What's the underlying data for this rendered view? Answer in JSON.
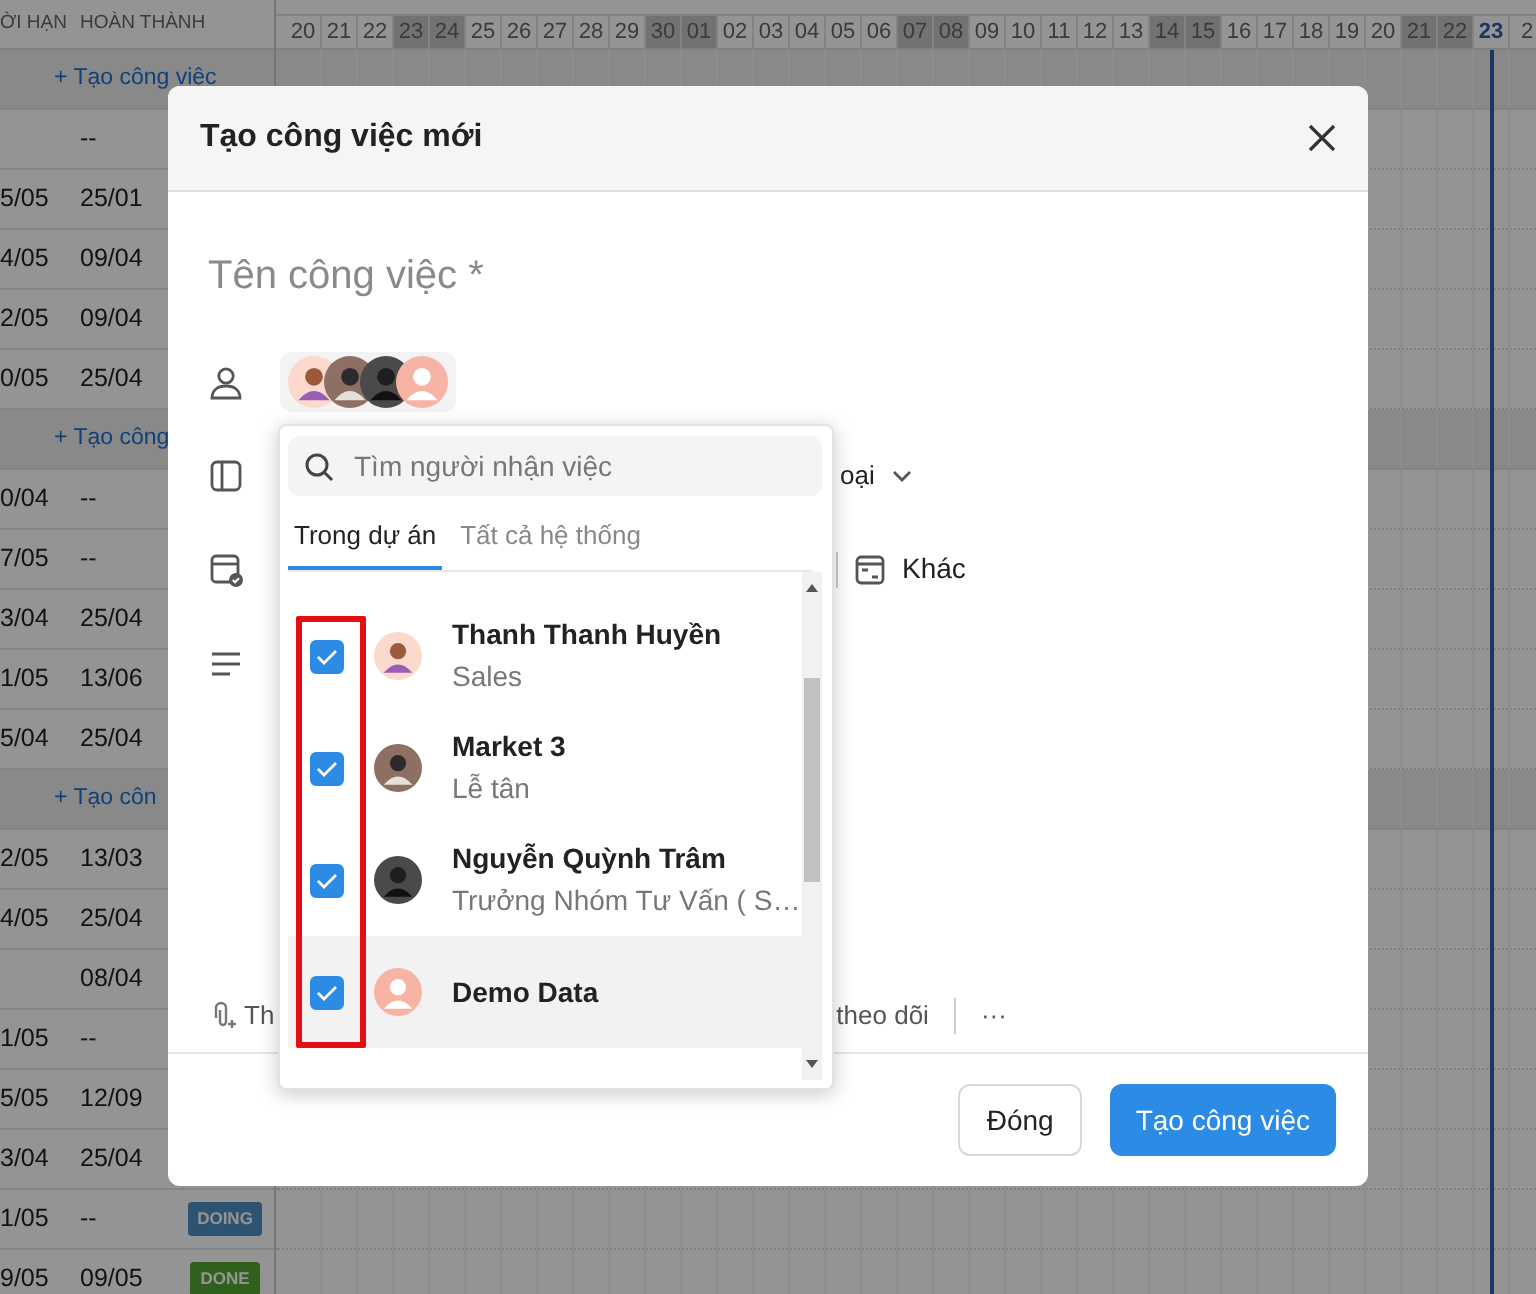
{
  "timeline": {
    "columns": [
      "ỜI HẠN",
      "HOÀN THÀNH"
    ],
    "rows": [
      {
        "kind": "group",
        "label": "+ Tạo công việc"
      },
      {
        "kind": "task",
        "completed": "--"
      },
      {
        "kind": "task",
        "deadline": "5/05",
        "completed": "25/01"
      },
      {
        "kind": "task",
        "deadline": "4/05",
        "completed": "09/04"
      },
      {
        "kind": "task",
        "deadline": "2/05",
        "completed": "09/04"
      },
      {
        "kind": "task",
        "deadline": "0/05",
        "completed": "25/04"
      },
      {
        "kind": "group",
        "label": "+ Tạo công"
      },
      {
        "kind": "task",
        "deadline": "0/04",
        "completed": "--"
      },
      {
        "kind": "task",
        "deadline": "7/05",
        "completed": "--"
      },
      {
        "kind": "task",
        "deadline": "3/04",
        "completed": "25/04"
      },
      {
        "kind": "task",
        "deadline": "1/05",
        "completed": "13/06"
      },
      {
        "kind": "task",
        "deadline": "5/04",
        "completed": "25/04"
      },
      {
        "kind": "group",
        "label": "+ Tạo côn"
      },
      {
        "kind": "task",
        "deadline": "2/05",
        "completed": "13/03"
      },
      {
        "kind": "task",
        "deadline": "4/05",
        "completed": "25/04"
      },
      {
        "kind": "task",
        "completed": "08/04"
      },
      {
        "kind": "task",
        "deadline": "1/05",
        "completed": "--"
      },
      {
        "kind": "task",
        "deadline": "5/05",
        "completed": "12/09"
      },
      {
        "kind": "task",
        "deadline": "3/04",
        "completed": "25/04"
      },
      {
        "kind": "task",
        "deadline": "1/05",
        "completed": "--",
        "status": {
          "label": "DOING",
          "kind": "doing"
        }
      },
      {
        "kind": "task",
        "deadline": "9/05",
        "completed": "09/05",
        "status": {
          "label": "DONE",
          "kind": "done"
        }
      }
    ],
    "days": [
      {
        "label": "20",
        "weekend": false,
        "today": false
      },
      {
        "label": "21",
        "weekend": false,
        "today": false
      },
      {
        "label": "22",
        "weekend": false,
        "today": false
      },
      {
        "label": "23",
        "weekend": true,
        "today": false
      },
      {
        "label": "24",
        "weekend": true,
        "today": false
      },
      {
        "label": "25",
        "weekend": false,
        "today": false
      },
      {
        "label": "26",
        "weekend": false,
        "today": false
      },
      {
        "label": "27",
        "weekend": false,
        "today": false
      },
      {
        "label": "28",
        "weekend": false,
        "today": false
      },
      {
        "label": "29",
        "weekend": false,
        "today": false
      },
      {
        "label": "30",
        "weekend": true,
        "today": false
      },
      {
        "label": "01",
        "weekend": true,
        "today": false
      },
      {
        "label": "02",
        "weekend": false,
        "today": false
      },
      {
        "label": "03",
        "weekend": false,
        "today": false
      },
      {
        "label": "04",
        "weekend": false,
        "today": false
      },
      {
        "label": "05",
        "weekend": false,
        "today": false
      },
      {
        "label": "06",
        "weekend": false,
        "today": false
      },
      {
        "label": "07",
        "weekend": true,
        "today": false
      },
      {
        "label": "08",
        "weekend": true,
        "today": false
      },
      {
        "label": "09",
        "weekend": false,
        "today": false
      },
      {
        "label": "10",
        "weekend": false,
        "today": false
      },
      {
        "label": "11",
        "weekend": false,
        "today": false
      },
      {
        "label": "12",
        "weekend": false,
        "today": false
      },
      {
        "label": "13",
        "weekend": false,
        "today": false
      },
      {
        "label": "14",
        "weekend": true,
        "today": false
      },
      {
        "label": "15",
        "weekend": true,
        "today": false
      },
      {
        "label": "16",
        "weekend": false,
        "today": false
      },
      {
        "label": "17",
        "weekend": false,
        "today": false
      },
      {
        "label": "18",
        "weekend": false,
        "today": false
      },
      {
        "label": "19",
        "weekend": false,
        "today": false
      },
      {
        "label": "20",
        "weekend": false,
        "today": false
      },
      {
        "label": "21",
        "weekend": true,
        "today": false
      },
      {
        "label": "22",
        "weekend": true,
        "today": false
      },
      {
        "label": "23",
        "weekend": false,
        "today": true
      },
      {
        "label": "2",
        "weekend": false,
        "today": false
      }
    ]
  },
  "dialog": {
    "title": "Tạo công việc mới",
    "name_placeholder": "Tên công việc *",
    "type_label": "oại",
    "other_label": "Khác",
    "toolbar": [
      {
        "kind": "attach",
        "label": "Th"
      },
      {
        "kind": "follow",
        "label": "theo dõi"
      },
      {
        "kind": "more",
        "label": "···"
      }
    ],
    "buttons": [
      {
        "kind": "secondary",
        "label": "Đóng"
      },
      {
        "kind": "primary",
        "label": "Tạo công việc"
      }
    ]
  },
  "picker": {
    "search_placeholder": "Tìm người nhận việc",
    "tabs": [
      {
        "label": "Trong dự án",
        "selected": true
      },
      {
        "label": "Tất cả hệ thống",
        "selected": false
      }
    ],
    "members": [
      {
        "name": "Thanh Thanh Huyền",
        "role": "Sales",
        "checked": true,
        "hovered": false
      },
      {
        "name": "Market 3",
        "role": "Lễ tân",
        "checked": true,
        "hovered": false
      },
      {
        "name": "Nguyễn Quỳnh Trâm",
        "role": "Trưởng Nhóm Tư Vấn ( S…",
        "checked": true,
        "hovered": false
      },
      {
        "name": "Demo Data",
        "checked": true,
        "hovered": true
      }
    ]
  }
}
